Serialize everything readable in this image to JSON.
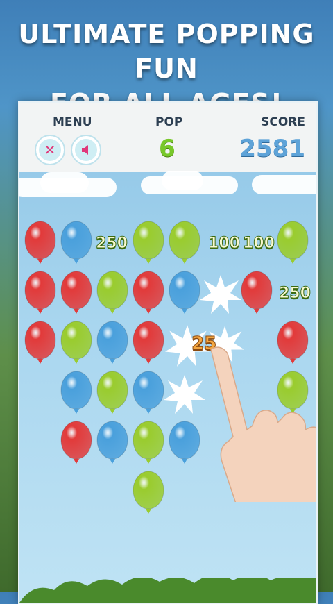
{
  "promo": {
    "line1": "ULTIMATE POPPING FUN",
    "line2": "FOR ALL AGES!"
  },
  "hud": {
    "menu_label": "MENU",
    "pop_label": "POP",
    "pop_value": "6",
    "score_label": "SCORE",
    "score_value": "2581"
  },
  "icons": {
    "close": "close-icon",
    "sound": "speaker-icon"
  },
  "points": [
    "250",
    "100",
    "100",
    "250",
    "25"
  ],
  "colors": {
    "red": "#e23a3a",
    "blue": "#4aa0dc",
    "green": "#9acc2e",
    "score_blue": "#5ea3d8",
    "pop_green": "#78c82a"
  }
}
